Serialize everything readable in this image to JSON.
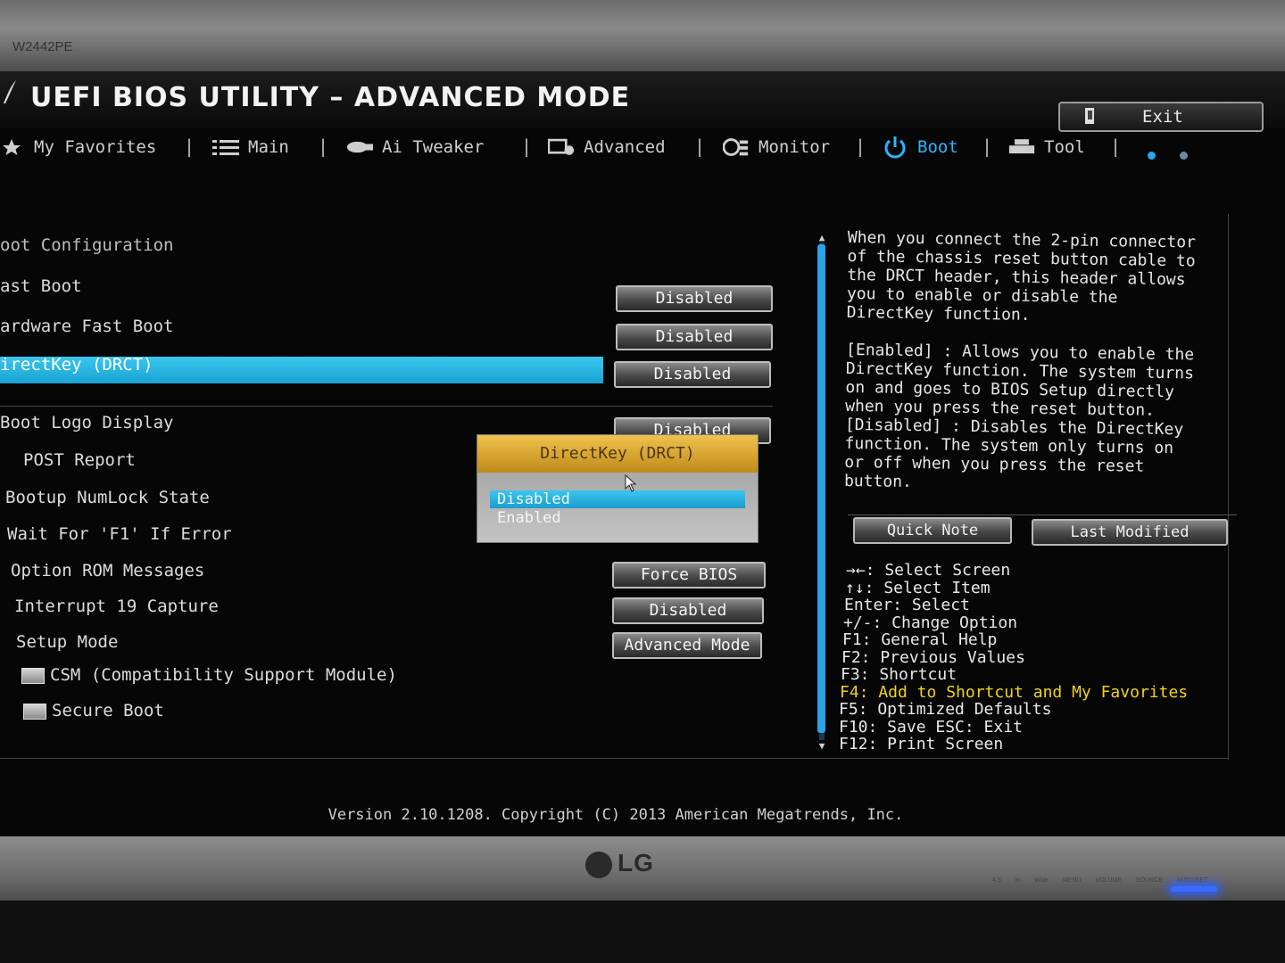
{
  "monitor": {
    "model": "W2442PE",
    "brand": "LG",
    "controls": "4:3 in Wide  MENU  VOLUME  SOURCE  AUTO/SET"
  },
  "header": {
    "title": "UEFI BIOS UTILITY – ADVANCED MODE",
    "exit_label": "Exit"
  },
  "menu": {
    "items": [
      {
        "label": "My Favorites",
        "icon": "star-icon"
      },
      {
        "label": "Main",
        "icon": "list-icon"
      },
      {
        "label": "Ai Tweaker",
        "icon": "tweaker-icon"
      },
      {
        "label": "Advanced",
        "icon": "advanced-icon"
      },
      {
        "label": "Monitor",
        "icon": "monitor-icon"
      },
      {
        "label": "Boot",
        "icon": "power-icon",
        "active": true
      },
      {
        "label": "Tool",
        "icon": "printer-icon"
      }
    ]
  },
  "boot": {
    "section_title": "oot Configuration",
    "rows": [
      {
        "label": "ast Boot",
        "value": "Disabled"
      },
      {
        "label": "ardware Fast Boot",
        "value": "Disabled"
      },
      {
        "label": "irectKey (DRCT)",
        "value": "Disabled"
      },
      {
        "label": "Boot Logo Display",
        "value": "Disabled"
      },
      {
        "label": "POST Report",
        "value": ""
      },
      {
        "label": "Bootup NumLock State",
        "value": ""
      },
      {
        "label": "Wait For 'F1' If Error",
        "value": ""
      },
      {
        "label": "Option ROM Messages",
        "value": "Force BIOS"
      },
      {
        "label": "Interrupt 19 Capture",
        "value": "Disabled"
      },
      {
        "label": "Setup Mode",
        "value": "Advanced Mode"
      }
    ],
    "submenus": [
      {
        "label": "CSM (Compatibility Support Module)"
      },
      {
        "label": "Secure Boot"
      }
    ]
  },
  "popup": {
    "title": "DirectKey (DRCT)",
    "options": [
      "Disabled",
      "Enabled"
    ],
    "selected": "Disabled"
  },
  "help": {
    "text": "When you connect the 2-pin connector\nof the chassis reset button cable to\nthe DRCT header, this header allows\nyou to enable or disable the\nDirectKey function.\n\n[Enabled] : Allows you to enable the\nDirectKey function. The system turns\non and goes to BIOS Setup directly\nwhen you press the reset button.\n[Disabled] : Disables the DirectKey\nfunction. The system only turns on\nor off when you press the reset\nbutton.",
    "quick_note": "Quick Note",
    "last_modified": "Last Modified"
  },
  "keys": [
    "→←: Select Screen",
    "↑↓: Select Item",
    "Enter: Select",
    "+/-: Change Option",
    "F1: General Help",
    "F2: Previous Values",
    "F3: Shortcut",
    "F4: Add to Shortcut and My Favorites",
    "F5: Optimized Defaults",
    "F10: Save  ESC: Exit",
    "F12: Print Screen"
  ],
  "footer": {
    "version": "Version 2.10.1208. Copyright (C) 2013 American Megatrends, Inc."
  },
  "colors": {
    "accent": "#26b6ff",
    "highlight": "#1aa8dc",
    "popup_title": "#e2ad36",
    "key_highlight": "#f2d21e"
  }
}
